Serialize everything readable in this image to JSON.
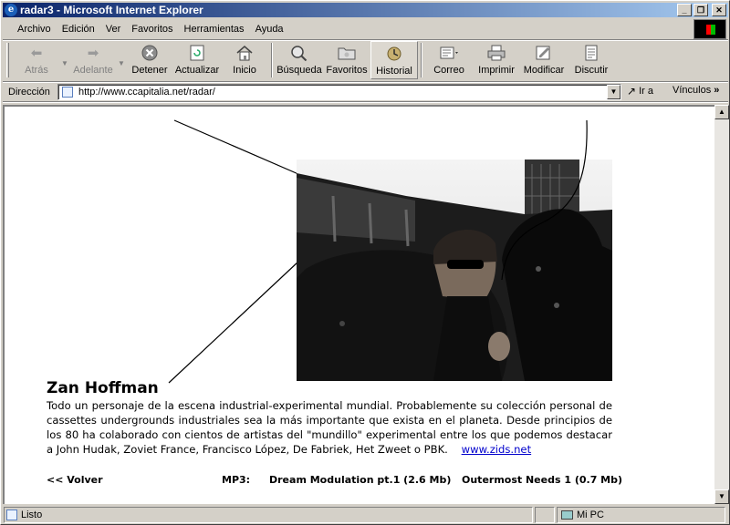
{
  "window": {
    "title": "radar3 - Microsoft Internet Explorer"
  },
  "menu": [
    "Archivo",
    "Edición",
    "Ver",
    "Favoritos",
    "Herramientas",
    "Ayuda"
  ],
  "toolbar": {
    "back": "Atrás",
    "forward": "Adelante",
    "stop": "Detener",
    "refresh": "Actualizar",
    "home": "Inicio",
    "search": "Búsqueda",
    "favorites": "Favoritos",
    "history": "Historial",
    "mail": "Correo",
    "print": "Imprimir",
    "edit": "Modificar",
    "discuss": "Discutir"
  },
  "address": {
    "label": "Dirección",
    "url": "http://www.ccapitalia.net/radar/",
    "go": "Ir a",
    "links": "Vínculos"
  },
  "page": {
    "name": "Zan Hoffman",
    "bio": "Todo un personaje de la escena industrial-experimental mundial. Probablemente su colección personal de cassettes undergrounds industriales sea la más importante que exista en el planeta. Desde principios de los 80 ha colaborado con cientos de artistas del \"mundillo\" experimental entre los que podemos destacar a John Hudak, Zoviet France, Francisco López, De Fabriek, Het Zweet o PBK.",
    "link": "www.zids.net",
    "back": "<< Volver",
    "mp3_label": "MP3:",
    "track1": "Dream Modulation pt.1 (2.6 Mb)",
    "track2": "Outermost Needs 1 (0.7 Mb)"
  },
  "status": {
    "text": "Listo",
    "zone": "Mi PC"
  },
  "colors": {
    "titlebar_start": "#0a246a",
    "titlebar_end": "#a6caf0",
    "link": "#0000cc"
  }
}
